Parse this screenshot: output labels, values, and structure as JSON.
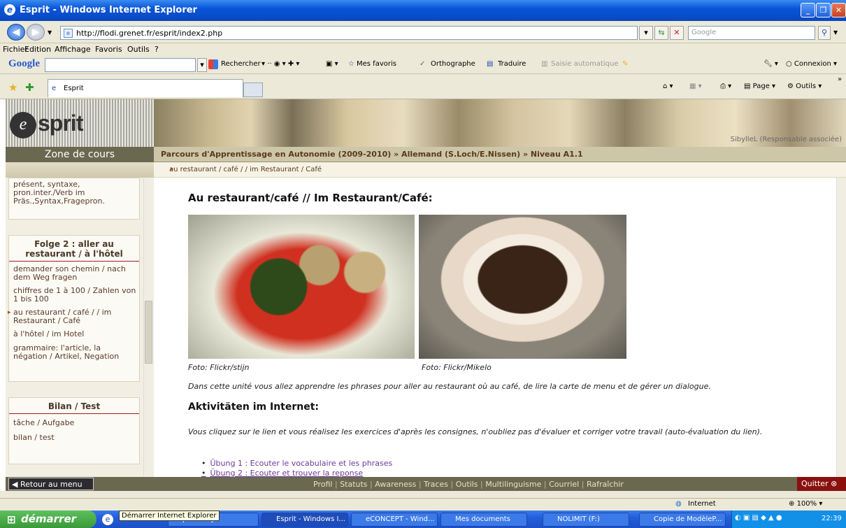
{
  "window": {
    "title": "Esprit - Windows Internet Explorer"
  },
  "address": {
    "url": "http://flodi.grenet.fr/esprit/index2.php",
    "search_placeholder": "Google"
  },
  "menu": [
    "Fichier",
    "Edition",
    "Affichage",
    "Favoris",
    "Outils",
    "?"
  ],
  "google_toolbar": {
    "logo": "Google",
    "search": "Rechercher",
    "favorites": "Mes favoris",
    "spell": "Orthographe",
    "translate": "Traduire",
    "autofill": "Saisie automatique",
    "login": "Connexion"
  },
  "favbar": {
    "tab": "Esprit",
    "page": "Page",
    "tools": "Outils"
  },
  "site": {
    "logo": "esprit",
    "user": "SibylleL (Responsable associée)",
    "zone": "Zone de cours",
    "breadcrumb": "Parcours d'Apprentissage en Autonomie (2009-2010) » Allemand (S.Loch/E.Nissen) » Niveau A1.1",
    "subcrumb": "au restaurant / café  / /  im Restaurant / Café"
  },
  "sidebar": {
    "top_text": "présent, syntaxe, pron.inter./Verb im Präs.,Syntax,Fragepron.",
    "folge2": {
      "title": "Folge 2 : aller au restaurant / à l'hôtel",
      "items": [
        "demander son chemin / nach dem Weg fragen",
        "chiffres de 1 à 100 / Zahlen von 1 bis 100",
        "au restaurant / café / / im Restaurant / Café",
        "à l'hôtel / im Hotel",
        "grammaire: l'article, la négation / Artikel, Negation"
      ]
    },
    "bilan": {
      "title": "Bilan / Test",
      "items": [
        "tâche / Aufgabe",
        "bilan / test"
      ]
    }
  },
  "content": {
    "title": "Au restaurant/café // Im Restaurant/Café:",
    "caption1": "Foto: Flickr/stijn",
    "caption2": "Foto: Flickr/Mikelo",
    "intro": "Dans cette unité vous allez apprendre les phrases pour aller au restaurant où au café, de lire la carte de menu et de gérer un dialogue.",
    "h2": "Aktivitäten im Internet:",
    "instructions": "Vous cliquez sur le lien et vous réalisez les exercices d'après les consignes, n'oubliez pas d'évaluer et corriger votre travail (auto-évaluation du lien).",
    "links": [
      "Übung 1 : Ecouter le vocabulaire et les phrases",
      "Übung 2 : Ecouter et trouver la reponse"
    ]
  },
  "bottom": {
    "retour": "Retour au menu",
    "nav": [
      "Profil",
      "Statuts",
      "Awareness",
      "Traces",
      "Outils",
      "Multilinguisme",
      "Courriel",
      "Rafraîchir"
    ],
    "quit": "Quitter"
  },
  "status": {
    "zone": "Internet",
    "zoom": "100%"
  },
  "taskbar": {
    "start": "démarrer",
    "tooltip": "Démarrer Internet Explorer",
    "items": [
      "pour siby...",
      "Esprit - Windows I...",
      "eCONCEPT - Wind...",
      "Mes documents",
      "NOLIMIT (F:)",
      "Copie de ModèleP..."
    ],
    "clock": "22:39"
  }
}
